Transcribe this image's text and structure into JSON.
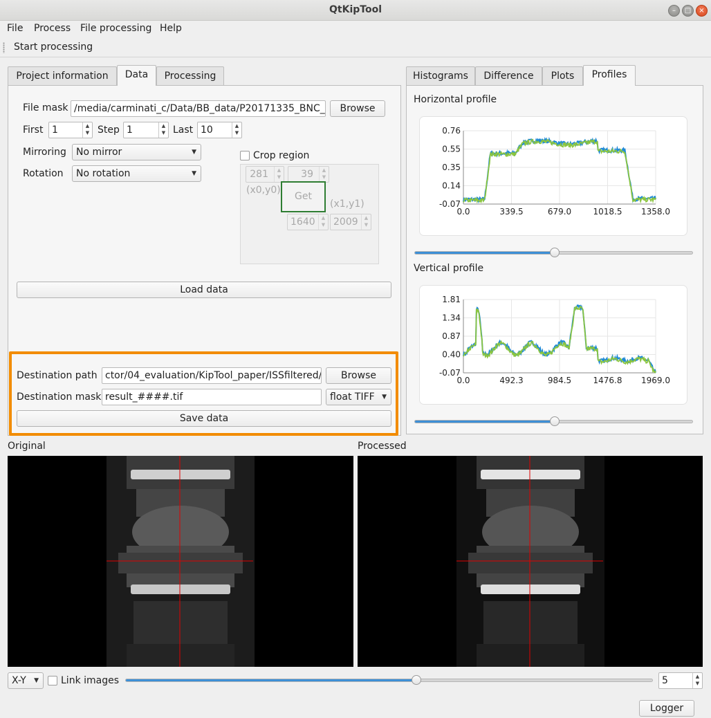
{
  "window": {
    "title": "QtKipTool"
  },
  "menu": [
    "File",
    "Process",
    "File processing",
    "Help"
  ],
  "toolbar": {
    "start_processing": "Start processing"
  },
  "left_tabs": [
    "Project information",
    "Data",
    "Processing"
  ],
  "data_tab": {
    "file_mask_label": "File mask",
    "file_mask_value": "/media/carminati_c/Data/BB_data/P20171335_BNC_c",
    "browse": "Browse",
    "first_label": "First",
    "first_value": "1",
    "step_label": "Step",
    "step_value": "1",
    "last_label": "Last",
    "last_value": "10",
    "mirroring_label": "Mirroring",
    "mirroring_value": "No mirror",
    "rotation_label": "Rotation",
    "rotation_value": "No rotation",
    "crop_label": "Crop region",
    "crop_x0": "281",
    "crop_y0": "39",
    "crop_x1": "1640",
    "crop_y1": "2009",
    "x0y0_label": "(x0,y0)",
    "x1y1_label": "(x1,y1)",
    "get_button": "Get",
    "load_data": "Load data"
  },
  "save_section": {
    "destination_path_label": "Destination path",
    "destination_path_value": "ctor/04_evaluation/KipTool_paper/ISSfiltered/",
    "browse": "Browse",
    "destination_mask_label": "Destination mask",
    "destination_mask_value": "result_####.tif",
    "format_value": "float TIFF",
    "save_data": "Save data",
    "highlight_color": "#f28c00"
  },
  "right_tabs": [
    "Histograms",
    "Difference",
    "Plots",
    "Profiles"
  ],
  "profiles": {
    "horizontal_title": "Horizontal profile",
    "horizontal_yticks": [
      "0.76",
      "0.55",
      "0.35",
      "0.14",
      "-0.07"
    ],
    "horizontal_xticks": [
      "0.0",
      "339.5",
      "679.0",
      "1018.5",
      "1358.0"
    ],
    "vertical_title": "Vertical profile",
    "vertical_yticks": [
      "1.81",
      "1.34",
      "0.87",
      "0.40",
      "-0.07"
    ],
    "vertical_xticks": [
      "0.0",
      "492.3",
      "984.5",
      "1476.8",
      "1969.0"
    ],
    "series_colors": [
      "#1f8ad6",
      "#8bc53f"
    ],
    "horizontal_slider_fraction": 0.5,
    "vertical_slider_fraction": 0.5
  },
  "images": {
    "original_label": "Original",
    "processed_label": "Processed"
  },
  "bottom": {
    "plane_value": "X-Y",
    "link_images_label": "Link images",
    "slice_value": "5",
    "slice_slider_fraction": 0.55,
    "logger": "Logger"
  }
}
